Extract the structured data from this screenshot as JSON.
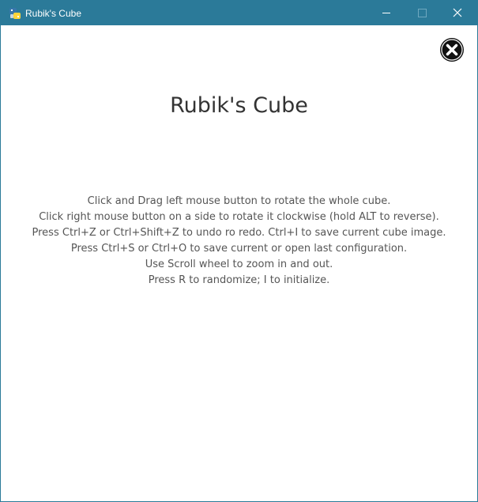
{
  "window": {
    "title": "Rubik's Cube",
    "titlebar_color": "#2b7a99",
    "icons": {
      "app": "python-icon",
      "minimize": "minimize-icon",
      "maximize": "maximize-icon",
      "close": "close-icon"
    }
  },
  "main": {
    "title": "Rubik's Cube",
    "close_icon": "close-circle-icon",
    "instructions": [
      "Click and Drag left mouse button to rotate the whole cube.",
      "Click right mouse button on a side to rotate it clockwise (hold ALT to reverse).",
      "Press Ctrl+Z or Ctrl+Shift+Z to undo ro redo. Ctrl+I to save current cube image.",
      "Press Ctrl+S or Ctrl+O to save current or open last configuration.",
      "Use Scroll wheel to zoom in and out.",
      "Press R to randomize; I to initialize."
    ]
  }
}
